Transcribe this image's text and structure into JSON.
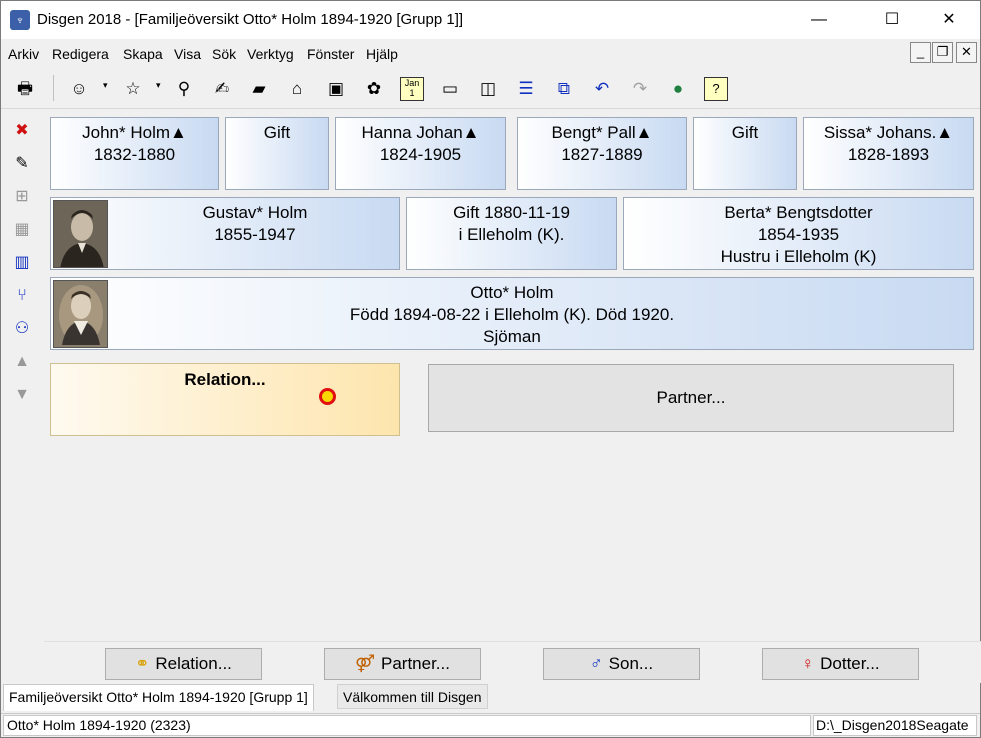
{
  "window": {
    "title": "Disgen 2018 - [Familjeöversikt Otto* Holm 1894-1920 [Grupp 1]]",
    "minimize": "—",
    "maximize": "☐",
    "close": "✕"
  },
  "menu": [
    "Arkiv",
    "Redigera",
    "Skapa",
    "Visa",
    "Sök",
    "Verktyg",
    "Fönster",
    "Hjälp"
  ],
  "mdi": {
    "minimize": "_",
    "restore": "❐",
    "close": "✕"
  },
  "toolbar": [
    "print-icon",
    "person-icon",
    "person-star-icon",
    "binoculars-icon",
    "hand-note-icon",
    "book-icon",
    "home-icon",
    "gift-icon",
    "map-icon",
    "calendar-icon",
    "window-icon",
    "columns-icon",
    "rows-icon",
    "cascade-icon",
    "undo-icon",
    "redo-icon",
    "globe-icon",
    "help-icon"
  ],
  "calendar_label": "Jan\n1",
  "help_label": "?",
  "grandparents": [
    {
      "name": "John* Holm▲",
      "years": "1832-1880"
    },
    {
      "name": "Gift",
      "years": ""
    },
    {
      "name": "Hanna Johan▲",
      "years": "1824-1905"
    },
    {
      "name": "Bengt* Pall▲",
      "years": "1827-1889"
    },
    {
      "name": "Gift",
      "years": ""
    },
    {
      "name": "Sissa* Johans.▲",
      "years": "1828-1893"
    }
  ],
  "father": {
    "name": "Gustav* Holm",
    "years": "1855-1947"
  },
  "marriage": {
    "line1": "Gift 1880-11-19",
    "line2": "i  Elleholm (K)."
  },
  "mother": {
    "name": "Berta* Bengtsdotter",
    "years": "1854-1935",
    "note": "Hustru  i Elleholm (K)"
  },
  "subject": {
    "name": "Otto* Holm",
    "line2": "Född 1894-08-22 i Elleholm (K). Död 1920.",
    "line3": "Sjöman"
  },
  "relation": {
    "label": "Relation..."
  },
  "partner": {
    "label": "Partner..."
  },
  "buttons": [
    {
      "icon": "rings-icon",
      "label": "Relation..."
    },
    {
      "icon": "couple-icon",
      "label": "Partner..."
    },
    {
      "icon": "son-icon",
      "label": "Son..."
    },
    {
      "icon": "daughter-icon",
      "label": "Dotter..."
    }
  ],
  "tabs": [
    "Familjeöversikt Otto* Holm 1894-1920 [Grupp 1]",
    "Välkommen till Disgen"
  ],
  "status": {
    "left": "Otto* Holm 1894-1920 (2323)",
    "right": "D:\\_Disgen2018Seagate"
  }
}
